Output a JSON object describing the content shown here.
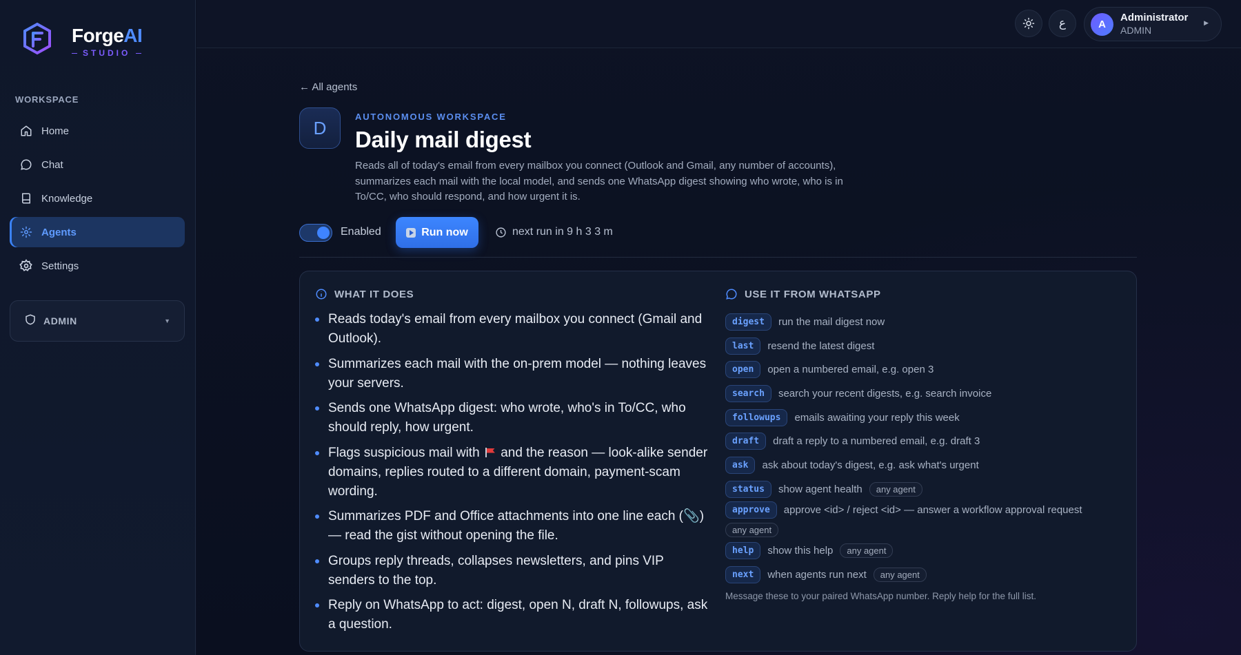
{
  "brand": {
    "name_main": "Forge",
    "name_accent": "AI",
    "subtitle": "STUDIO",
    "accent_color": "#4f8cff",
    "secondary_color": "#7c5cff"
  },
  "sidebar": {
    "section_label": "WORKSPACE",
    "items": [
      {
        "label": "Home",
        "icon": "home-icon",
        "active": false
      },
      {
        "label": "Chat",
        "icon": "chat-icon",
        "active": false
      },
      {
        "label": "Knowledge",
        "icon": "book-icon",
        "active": false
      },
      {
        "label": "Agents",
        "icon": "sparkle-icon",
        "active": true
      },
      {
        "label": "Settings",
        "icon": "gear-icon",
        "active": false
      }
    ],
    "admin_label": "ADMIN"
  },
  "topbar": {
    "theme_icon": "sun-icon",
    "language_glyph": "ع",
    "user": {
      "initial": "A",
      "name": "Administrator",
      "role": "ADMIN"
    }
  },
  "agent": {
    "back_link": "← All agents",
    "badge_letter": "D",
    "eyebrow": "AUTONOMOUS WORKSPACE",
    "title": "Daily mail digest",
    "description": "Reads all of today's email from every mailbox you connect (Outlook and Gmail, any number of accounts), summarizes each mail with the local model, and sends one WhatsApp digest showing who wrote, who is in To/CC, who should respond, and how urgent it is.",
    "enabled": true,
    "enabled_label": "Enabled",
    "run_label": "Run now",
    "next_run_label": "next run in 9 h 3 3 m"
  },
  "what_it_does": {
    "title": "WHAT IT DOES",
    "bullets": [
      "Reads today's email from every mailbox you connect (Gmail and Outlook).",
      "Summarizes each mail with the on-prem model — nothing leaves your servers.",
      "Sends one WhatsApp digest: who wrote, who's in To/CC, who should reply, how urgent.",
      "Groups reply threads, collapses newsletters, and pins VIP senders to the top.",
      "Reply on WhatsApp to act: digest, open N, draft N, followups, ask a question."
    ],
    "flag_bullet": {
      "before": "Flags suspicious mail with",
      "after": " and the reason — look-alike sender domains, replies routed to a different domain, payment-scam wording."
    },
    "attach_bullet": {
      "before": "Summarizes PDF and Office attachments into one line each (",
      "icon": "📎",
      "after": ") — read the gist without opening the file."
    }
  },
  "whatsapp": {
    "title": "USE IT FROM WHATSAPP",
    "commands": [
      {
        "cmd": "digest",
        "desc": "run the mail digest now",
        "tag": ""
      },
      {
        "cmd": "last",
        "desc": "resend the latest digest",
        "tag": ""
      },
      {
        "cmd": "open",
        "desc": "open a numbered email, e.g. open 3",
        "tag": ""
      },
      {
        "cmd": "search",
        "desc": "search your recent digests, e.g. search invoice",
        "tag": ""
      },
      {
        "cmd": "followups",
        "desc": "emails awaiting your reply this week",
        "tag": ""
      },
      {
        "cmd": "draft",
        "desc": "draft a reply to a numbered email, e.g. draft 3",
        "tag": ""
      },
      {
        "cmd": "ask",
        "desc": "ask about today's digest, e.g. ask what's urgent",
        "tag": ""
      },
      {
        "cmd": "status",
        "desc": "show agent health",
        "tag": "any agent"
      },
      {
        "cmd": "approve",
        "desc": "approve <id> / reject <id> — answer a workflow approval request",
        "tag": "any agent"
      },
      {
        "cmd": "help",
        "desc": "show this help",
        "tag": "any agent"
      },
      {
        "cmd": "next",
        "desc": "when agents run next",
        "tag": "any agent"
      }
    ],
    "footer": "Message these to your paired WhatsApp number. Reply help for the full list."
  }
}
